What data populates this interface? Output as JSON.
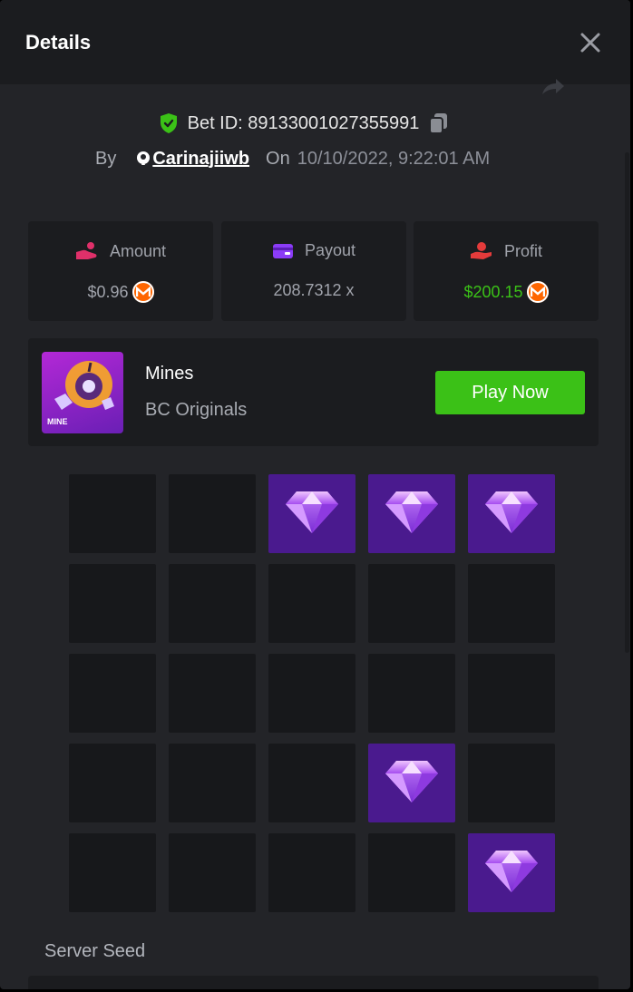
{
  "header": {
    "title": "Details"
  },
  "bet": {
    "id_text": "Bet ID: 89133001027355991",
    "by_label": "By",
    "user": "Carinajiiwb",
    "on_label": "On",
    "datetime": "10/10/2022, 9:22:01 AM"
  },
  "stats": {
    "amount": {
      "label": "Amount",
      "value": "$0.96",
      "icon": "hand-coin-icon",
      "value_color": "#a0a3ab",
      "icon_color": "#e0306a"
    },
    "payout": {
      "label": "Payout",
      "value": "208.7312 x",
      "icon": "wallet-icon",
      "value_color": "#a0a3ab",
      "icon_color": "#8b3cf7"
    },
    "profit": {
      "label": "Profit",
      "value": "$200.15",
      "icon": "profit-hand-icon",
      "value_color": "#3bc117",
      "icon_color": "#e43b3b"
    }
  },
  "currency_icon": "monero-coin-icon",
  "game": {
    "name": "Mines",
    "provider": "BC Originals",
    "thumb_tag": "MINE",
    "play_button": "Play Now"
  },
  "board": {
    "rows": 5,
    "cols": 5,
    "cells": [
      0,
      0,
      1,
      1,
      1,
      0,
      0,
      0,
      0,
      0,
      0,
      0,
      0,
      0,
      0,
      0,
      0,
      0,
      1,
      0,
      0,
      0,
      0,
      0,
      1
    ],
    "gem_icon": "diamond-icon"
  },
  "seeds": {
    "server_seed_label": "Server Seed"
  },
  "colors": {
    "accent_green": "#3bc117",
    "gem_bg": "#4a1a8e",
    "panel": "#232428",
    "card": "#1b1c1f"
  }
}
